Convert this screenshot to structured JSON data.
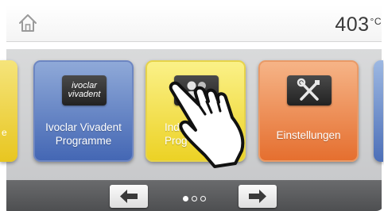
{
  "header": {
    "temperature_value": "403",
    "temperature_unit": "°C"
  },
  "carousel": {
    "partial_left_text": "e",
    "tiles": [
      {
        "logo_line1": "ivoclar",
        "logo_line2": "vivadent",
        "label_line1": "Ivoclar Vivadent",
        "label_line2": "Programme"
      },
      {
        "label_line1": "Indivi",
        "label_line2": "Prog"
      },
      {
        "label_line1": "Einstellungen",
        "label_line2": ""
      }
    ]
  },
  "pagination": {
    "current_page": 1,
    "total_pages": 3
  },
  "colors": {
    "ivoclar_tile": "#4a6bb6",
    "individual_tile": "#efd430",
    "settings_tile": "#e97a3c",
    "nav_bar": "#5a5b5d"
  },
  "icons": {
    "home": "home-icon",
    "individual": "users-icon",
    "settings": "tools-icon",
    "prev": "arrow-left-icon",
    "next": "arrow-right-icon"
  }
}
